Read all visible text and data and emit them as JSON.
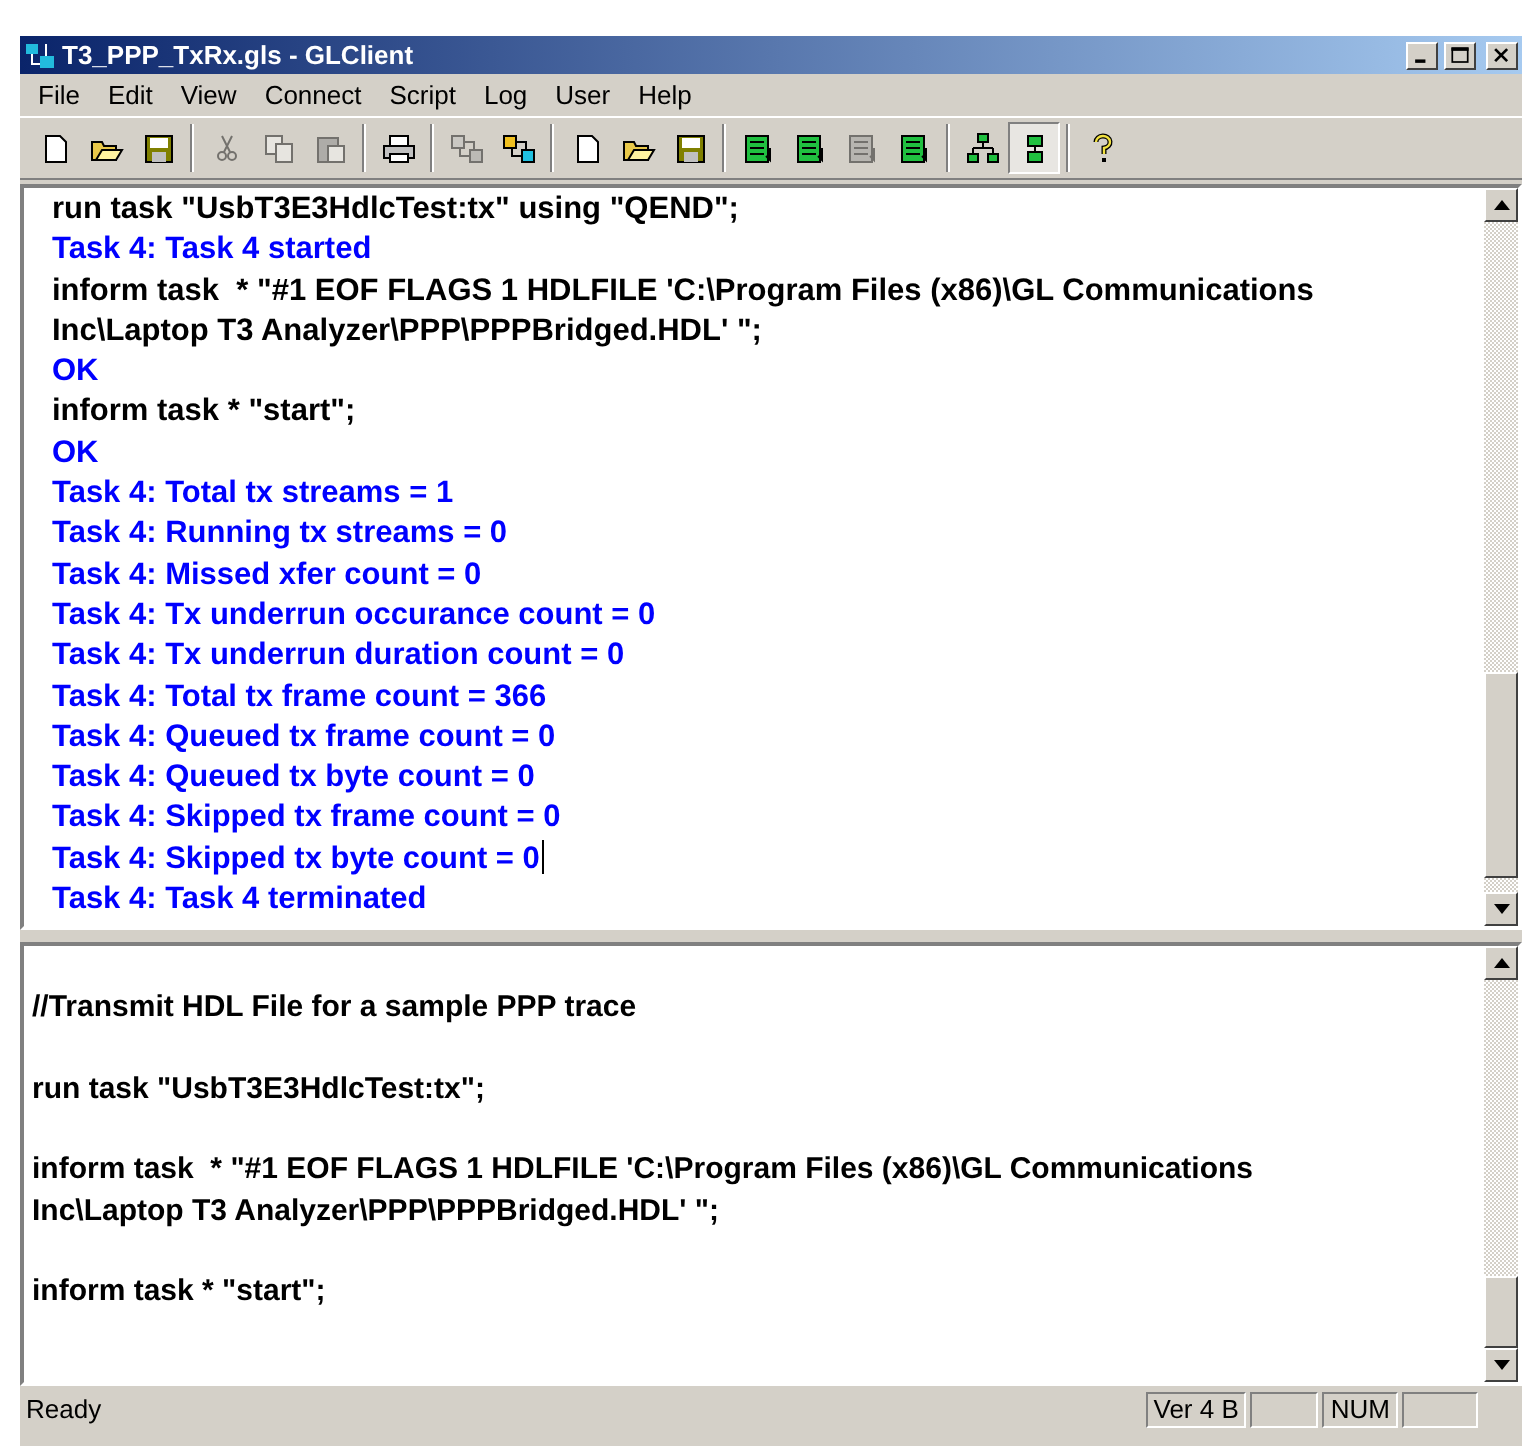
{
  "window": {
    "title": "T3_PPP_TxRx.gls - GLClient"
  },
  "menu": [
    "File",
    "Edit",
    "View",
    "Connect",
    "Script",
    "Log",
    "User",
    "Help"
  ],
  "toolbar": [
    {
      "buttons": [
        {
          "kind": "new",
          "disabled": false,
          "pressed": false
        },
        {
          "kind": "open",
          "disabled": false,
          "pressed": false
        },
        {
          "kind": "save",
          "disabled": false,
          "pressed": false
        }
      ]
    },
    {
      "buttons": [
        {
          "kind": "cut",
          "disabled": true,
          "pressed": false
        },
        {
          "kind": "copy",
          "disabled": true,
          "pressed": false
        },
        {
          "kind": "paste",
          "disabled": true,
          "pressed": false
        }
      ]
    },
    {
      "buttons": [
        {
          "kind": "print",
          "disabled": false,
          "pressed": false
        }
      ]
    },
    {
      "buttons": [
        {
          "kind": "connect",
          "disabled": true,
          "pressed": false
        },
        {
          "kind": "connect",
          "disabled": false,
          "pressed": false
        }
      ]
    },
    {
      "buttons": [
        {
          "kind": "new",
          "disabled": false,
          "pressed": false
        },
        {
          "kind": "open",
          "disabled": false,
          "pressed": false
        },
        {
          "kind": "save",
          "disabled": false,
          "pressed": false
        }
      ]
    },
    {
      "buttons": [
        {
          "kind": "list",
          "disabled": false,
          "pressed": false
        },
        {
          "kind": "list",
          "disabled": false,
          "pressed": false
        },
        {
          "kind": "list",
          "disabled": true,
          "pressed": false
        },
        {
          "kind": "list",
          "disabled": false,
          "pressed": false
        }
      ]
    },
    {
      "buttons": [
        {
          "kind": "tree",
          "disabled": false,
          "pressed": false
        },
        {
          "kind": "split",
          "disabled": false,
          "pressed": true
        }
      ]
    },
    {
      "buttons": [
        {
          "kind": "help",
          "disabled": false,
          "pressed": false
        }
      ]
    }
  ],
  "output_pane": {
    "lines": [
      {
        "kind": "command",
        "text": "run task \"UsbT3E3HdlcTest:tx\" using \"QEND\";",
        "cursor": false
      },
      {
        "kind": "response",
        "text": "Task 4: Task 4 started",
        "cursor": false
      },
      {
        "kind": "command",
        "text": "inform task  * \"#1 EOF FLAGS 1 HDLFILE 'C:\\Program Files (x86)\\GL Communications",
        "cursor": false
      },
      {
        "kind": "command",
        "text": "Inc\\Laptop T3 Analyzer\\PPP\\PPPBridged.HDL' \";",
        "cursor": false
      },
      {
        "kind": "response",
        "text": "OK",
        "cursor": false
      },
      {
        "kind": "command",
        "text": "inform task * \"start\";",
        "cursor": false
      },
      {
        "kind": "response",
        "text": "OK",
        "cursor": false
      },
      {
        "kind": "response",
        "text": "Task 4: Total tx streams = 1",
        "cursor": false
      },
      {
        "kind": "response",
        "text": "Task 4: Running tx streams = 0",
        "cursor": false
      },
      {
        "kind": "response",
        "text": "Task 4: Missed xfer count = 0",
        "cursor": false
      },
      {
        "kind": "response",
        "text": "Task 4: Tx underrun occurance count = 0",
        "cursor": false
      },
      {
        "kind": "response",
        "text": "Task 4: Tx underrun duration count = 0",
        "cursor": false
      },
      {
        "kind": "response",
        "text": "Task 4: Total tx frame count = 366",
        "cursor": false
      },
      {
        "kind": "response",
        "text": "Task 4: Queued tx frame count = 0",
        "cursor": false
      },
      {
        "kind": "response",
        "text": "Task 4: Queued tx byte count = 0",
        "cursor": false
      },
      {
        "kind": "response",
        "text": "Task 4: Skipped tx frame count = 0",
        "cursor": false
      },
      {
        "kind": "response",
        "text": "Task 4: Skipped tx byte count = 0",
        "cursor": true
      },
      {
        "kind": "response",
        "text": "Task 4: Task 4 terminated",
        "cursor": false
      }
    ]
  },
  "script_pane": {
    "lines": [
      {
        "text": "//Transmit HDL File for a sample PPP trace",
        "gap_before": true
      },
      {
        "text": "run task \"UsbT3E3HdlcTest:tx\";",
        "gap_before": true
      },
      {
        "text": "inform task  * \"#1 EOF FLAGS 1 HDLFILE 'C:\\Program Files (x86)\\GL Communications",
        "gap_before": true
      },
      {
        "text": "Inc\\Laptop T3 Analyzer\\PPP\\PPPBridged.HDL' \";",
        "gap_before": false
      },
      {
        "text": "inform task * \"start\";",
        "gap_before": true
      }
    ]
  },
  "status_bar": {
    "message": "Ready",
    "version": "Ver 4 B",
    "num": "NUM"
  }
}
